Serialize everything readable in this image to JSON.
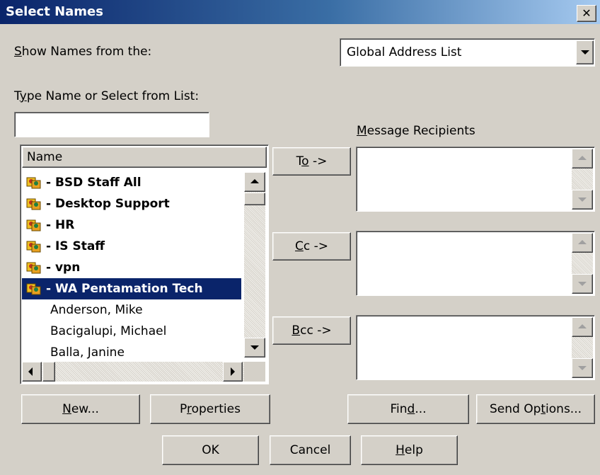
{
  "window": {
    "title": "Select Names",
    "close_glyph": "✕"
  },
  "show_names": {
    "label_access": "S",
    "label_rest": "how Names from the:",
    "selected": "Global Address List"
  },
  "type_name": {
    "label_pre": "T",
    "label_access": "y",
    "label_rest": "pe Name or Select from List:",
    "value": ""
  },
  "name_list": {
    "header": "Name",
    "items": [
      {
        "label": "- BSD Staff All",
        "bold": true,
        "icon": "distribution-list-icon"
      },
      {
        "label": "- Desktop Support",
        "bold": true,
        "icon": "distribution-list-icon"
      },
      {
        "label": "- HR",
        "bold": true,
        "icon": "distribution-list-icon"
      },
      {
        "label": "- IS Staff",
        "bold": true,
        "icon": "distribution-list-icon"
      },
      {
        "label": "- vpn",
        "bold": true,
        "icon": "distribution-list-icon"
      },
      {
        "label": "- WA Pentamation Tech",
        "bold": true,
        "icon": "distribution-list-icon",
        "selected": true
      },
      {
        "label": "Anderson, Mike",
        "bold": false
      },
      {
        "label": "Bacigalupi, Michael",
        "bold": false
      },
      {
        "label": "Balla, Janine",
        "bold": false
      }
    ]
  },
  "recipients": {
    "label_access": "M",
    "label_rest": "essage Recipients",
    "to": {
      "pre": "T",
      "access": "o",
      "post": " ->"
    },
    "cc": {
      "pre": "",
      "access": "C",
      "post": "c ->"
    },
    "bcc": {
      "pre": "",
      "access": "B",
      "post": "cc ->"
    }
  },
  "buttons": {
    "new": {
      "pre": "",
      "access": "N",
      "post": "ew..."
    },
    "properties": {
      "pre": "P",
      "access": "r",
      "post": "operties"
    },
    "find": {
      "pre": "Fin",
      "access": "d",
      "post": "..."
    },
    "send_options": {
      "pre": "Send Op",
      "access": "t",
      "post": "ions..."
    },
    "ok": "OK",
    "cancel": "Cancel",
    "help": {
      "pre": "",
      "access": "H",
      "post": "elp"
    }
  },
  "colors": {
    "face": "#d4d0c8",
    "selection": "#0a246a",
    "title_start": "#0a246a",
    "title_end": "#a6caf0"
  }
}
